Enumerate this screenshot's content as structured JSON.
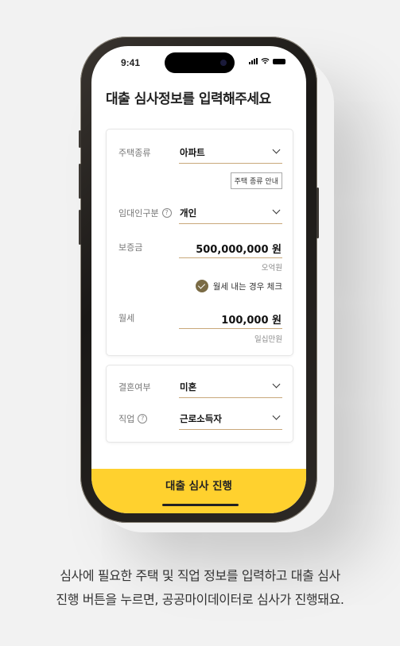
{
  "status_bar": {
    "time": "9:41"
  },
  "page": {
    "title": "대출 심사정보를 입력해주세요"
  },
  "form": {
    "housing_type": {
      "label": "주택종류",
      "value": "아파트",
      "guide_button": "주택 종류 안내"
    },
    "lessor_type": {
      "label": "임대인구분",
      "help": "?",
      "value": "개인"
    },
    "deposit": {
      "label": "보증금",
      "value": "500,000,000 원",
      "reading": "오억원"
    },
    "monthly_check": {
      "label": "월세 내는 경우 체크",
      "checked": true
    },
    "monthly_rent": {
      "label": "월세",
      "value": "100,000 원",
      "reading": "일십만원"
    },
    "marital": {
      "label": "결혼여부",
      "value": "미혼"
    },
    "job": {
      "label": "직업",
      "help": "?",
      "value": "근로소득자"
    }
  },
  "cta": {
    "label": "대출 심사 진행"
  },
  "caption": {
    "line1": "심사에 필요한 주택 및 직업 정보를 입력하고 대출 심사",
    "line2": "진행 버튼을 누르면, 공공마이데이터로 심사가 진행돼요."
  },
  "colors": {
    "accent_yellow": "#ffd12e",
    "field_underline": "#c9a87a",
    "check_fill": "#7a6b45"
  }
}
